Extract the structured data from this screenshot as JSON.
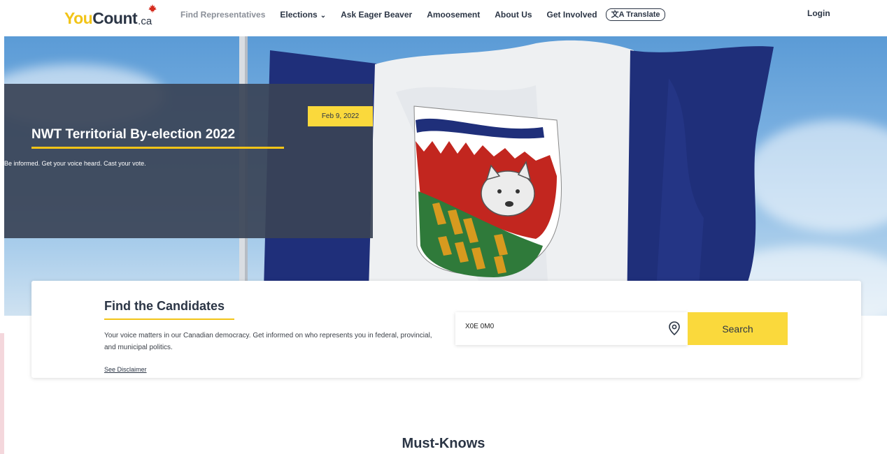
{
  "logo": {
    "you": "You",
    "count": "Count",
    "ca": ".ca"
  },
  "nav": {
    "items": [
      {
        "label": "Find Representatives"
      },
      {
        "label": "Elections"
      },
      {
        "label": "Ask Eager Beaver"
      },
      {
        "label": "Amoosement"
      },
      {
        "label": "About Us"
      },
      {
        "label": "Get Involved"
      }
    ],
    "translate": "Translate",
    "login": "Login"
  },
  "hero": {
    "date": "Feb 9, 2022",
    "title": "NWT Territorial By-election 2022",
    "subtitle": "Be informed. Get your voice heard. Cast your vote."
  },
  "candidates": {
    "title": "Find the Candidates",
    "description": "Your voice matters in our Canadian democracy. Get informed on who represents you in federal, provincial, and municipal politics.",
    "disclaimer": "See Disclaimer",
    "postal_value": "X0E 0M0",
    "search_label": "Search"
  },
  "section": {
    "title": "Must-Knows"
  },
  "colors": {
    "accent": "#fad93c",
    "navy": "#2b3545",
    "flag_blue": "#1f2f7a"
  }
}
